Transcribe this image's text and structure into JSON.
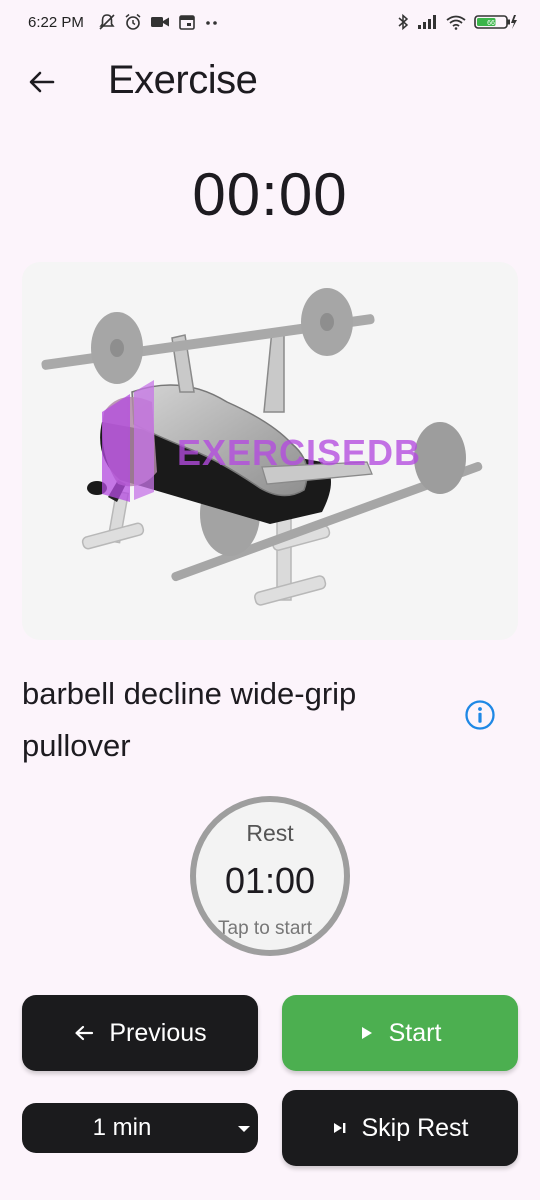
{
  "status_bar": {
    "time": "6:22 PM",
    "left_icons": [
      "notifications-off-icon",
      "alarm-icon",
      "video-icon",
      "calendar-icon",
      "more-dots-icon"
    ],
    "right_icons": [
      "bluetooth-icon",
      "signal-icon",
      "wifi-icon",
      "battery-charging-icon"
    ],
    "battery_level": "66"
  },
  "header": {
    "title": "Exercise",
    "back_icon": "arrow-back-icon"
  },
  "timer": {
    "value": "00:00"
  },
  "exercise": {
    "image_watermark": "EXERCISEDB",
    "name": "barbell decline wide-grip pullover",
    "info_icon": "info-icon"
  },
  "rest": {
    "label": "Rest",
    "time": "01:00",
    "hint": "Tap to start"
  },
  "controls": {
    "previous_label": "Previous",
    "start_label": "Start",
    "rest_duration": "1 min",
    "skip_rest_label": "Skip Rest"
  },
  "colors": {
    "background": "#fcf4fb",
    "dark_button": "#1b1b1d",
    "start_green": "#4caf50",
    "info_blue": "#1e88e5",
    "rest_ring": "#9e9e9e",
    "watermark_purple": "#b44be0"
  }
}
